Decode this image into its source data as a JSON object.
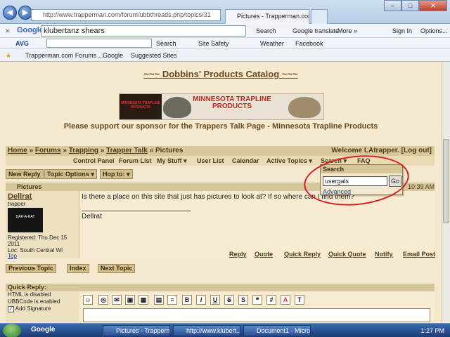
{
  "browser": {
    "address": "http://www.trapperman.com/forum/ubbthreads.php/topics/31",
    "tabs": [
      "Pictures - Trapperman.com...",
      ""
    ],
    "win_controls": {
      "minimize": "–",
      "maximize": "□",
      "close": "✕"
    }
  },
  "google_toolbar": {
    "logo": "Google",
    "query": "klubertanz shears",
    "search": "Search",
    "translate": "Google translate",
    "more": "More »",
    "signin": "Sign In",
    "options": "Options..."
  },
  "avg_toolbar": {
    "logo": "AVG",
    "search": "Search",
    "site_safety": "Site Safety",
    "weather": "Weather",
    "facebook": "Facebook"
  },
  "favorites": {
    "items": [
      "Trapperman.com Forums ...",
      "Google",
      "Suggested Sites"
    ]
  },
  "page": {
    "catalog_title": "~~~ Dobbins' Products Catalog ~~~",
    "banner_title": "MINNESOTA TRAPLINE PRODUCTS",
    "banner_logo": "MINNESOTA TRAPLINE PRODUCTS",
    "support_text": "Please support our sponsor for the Trappers Talk Page - Minnesota Trapline Products",
    "breadcrumbs": [
      "Home",
      "Forums",
      "Trapping",
      "Trapper Talk",
      "Pictures"
    ],
    "welcome": "Welcome LAtrapper. [Log out]",
    "menu": [
      "Control Panel",
      "Forum List",
      "My Stuff ▾",
      "User List",
      "Calendar",
      "Active Topics ▾",
      "Search ▾",
      "FAQ"
    ],
    "actions": [
      "New Reply",
      "Topic Options ▾",
      "Hop to: ▾"
    ]
  },
  "post": {
    "section": "Pictures",
    "time": "10:39 AM",
    "author": "Dellrat",
    "rank": "trapper",
    "avatar_text": "DAR-A-RAT",
    "registered": "Registered: Thu Dec 15 2011",
    "location": "Loc: South Central WI",
    "top": "Top",
    "body": "Is there a place on this site that just has pictures to look at? If so where can I find them?",
    "signature": "Dellrat",
    "buttons": [
      "Reply",
      "Quote",
      "Quick Reply",
      "Quick Quote",
      "Notify",
      "Email Post"
    ]
  },
  "topic_nav": [
    "Previous Topic",
    "Index",
    "Next Topic"
  ],
  "quick_reply": {
    "header": "Quick Reply:",
    "html": "HTML is disabled",
    "ubb": "UBBCode is enabled",
    "signature": "Add Signature",
    "editor": [
      "B",
      "I",
      "U",
      "S",
      "S",
      "❝",
      "#",
      "A",
      "T"
    ]
  },
  "search_popup": {
    "header": "Search",
    "value": "usergals",
    "go": "Go",
    "advanced": "Advanced"
  },
  "taskbar": {
    "google": "Google",
    "tasks": [
      "Pictures - Trapperm...",
      "http://www.klubert...",
      "Document1 - Micro..."
    ],
    "clock": "1:27 PM"
  }
}
